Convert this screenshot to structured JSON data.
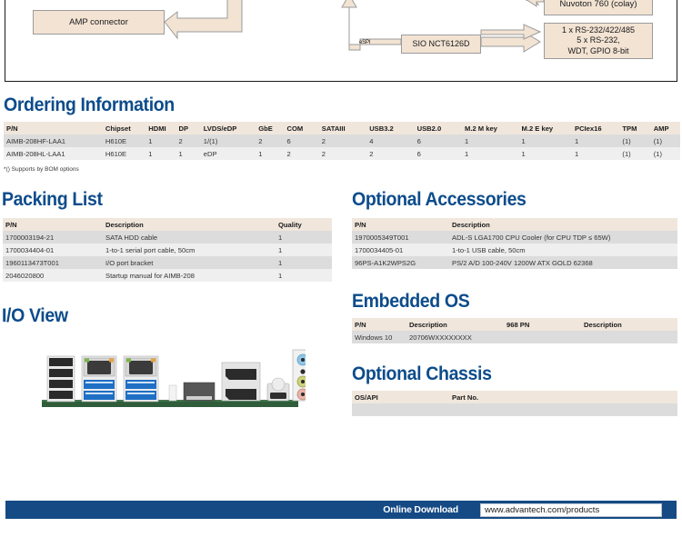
{
  "diagram": {
    "blocks": [
      {
        "id": "amp-connector",
        "label": "AMP connector"
      },
      {
        "id": "mid-block",
        "label": ""
      },
      {
        "id": "sio",
        "label": "SIO NCT6126D"
      },
      {
        "id": "upper-right",
        "label": ""
      },
      {
        "id": "nuvoton",
        "label": "Nuvoton 760 (colay)"
      },
      {
        "id": "serial-io",
        "label": "1 x RS-232/422/485\n5 x RS-232,\nWDT, GPIO 8-bit"
      }
    ],
    "bus_labels": [
      {
        "id": "espi",
        "label": "eSPI"
      }
    ],
    "box_fill": "#f2e3d3",
    "box_stroke": "#9b9b9b"
  },
  "ordering_information": {
    "title": "Ordering Information",
    "headers": [
      "P/N",
      "Chipset",
      "HDMI",
      "DP",
      "LVDS/eDP",
      "GbE",
      "COM",
      "SATAIII",
      "USB3.2",
      "USB2.0",
      "M.2 M key",
      "M.2 E key",
      "PCIex16",
      "TPM",
      "AMP"
    ],
    "rows": [
      [
        "AIMB-208HF-LAA1",
        "H610E",
        "1",
        "2",
        "1/(1)",
        "2",
        "6",
        "2",
        "4",
        "6",
        "1",
        "1",
        "1",
        "(1)",
        "(1)"
      ],
      [
        "AIMB-208HL-LAA1",
        "H610E",
        "1",
        "1",
        "eDP",
        "1",
        "2",
        "2",
        "2",
        "6",
        "1",
        "1",
        "1",
        "(1)",
        "(1)"
      ]
    ],
    "footnote": "*() Supports by BOM options"
  },
  "packing_list": {
    "title": "Packing List",
    "headers": [
      "P/N",
      "Description",
      "Quality"
    ],
    "rows": [
      [
        "1700003194-21",
        "SATA HDD cable",
        "1"
      ],
      [
        "1700034404-01",
        "1-to-1 serial port cable, 50cm",
        "1"
      ],
      [
        "1960113473T001",
        "I/O port bracket",
        "1"
      ],
      [
        "2046020800",
        "Startup manual for AIMB-208",
        "1"
      ]
    ]
  },
  "optional_accessories": {
    "title": "Optional Accessories",
    "headers": [
      "P/N",
      "Description"
    ],
    "rows": [
      [
        "1970005349T001",
        "ADL-S LGA1700 CPU Cooler (for CPU TDP ≤ 65W)"
      ],
      [
        "1700034405-01",
        "1-to-1 USB cable, 50cm"
      ],
      [
        "96PS-A1K2WPS2G",
        "PS/2 A/D 100-240V 1200W ATX GOLD 62368"
      ]
    ]
  },
  "embedded_os": {
    "title": "Embedded OS",
    "headers": [
      "P/N",
      "Description",
      "968 PN",
      "Description"
    ],
    "rows": [
      [
        "Windows 10",
        "20706WXXXXXXXX",
        "",
        ""
      ]
    ]
  },
  "optional_chassis": {
    "title": "Optional Chassis",
    "headers": [
      "OS/API",
      "Part No."
    ],
    "rows": [
      [
        "",
        ""
      ]
    ]
  },
  "io_view": {
    "title": "I/O View",
    "image_alt": "motherboard-rear-io-panel"
  },
  "footer": {
    "label": "Online Download",
    "url": "www.advantech.com/products",
    "bar_color": "#154a85"
  },
  "theme": {
    "heading_blue": "#0d4c8b",
    "table_header_bg": "#f0e6dc",
    "row_odd_bg": "#dcdcdc",
    "row_even_bg": "#efefef"
  }
}
